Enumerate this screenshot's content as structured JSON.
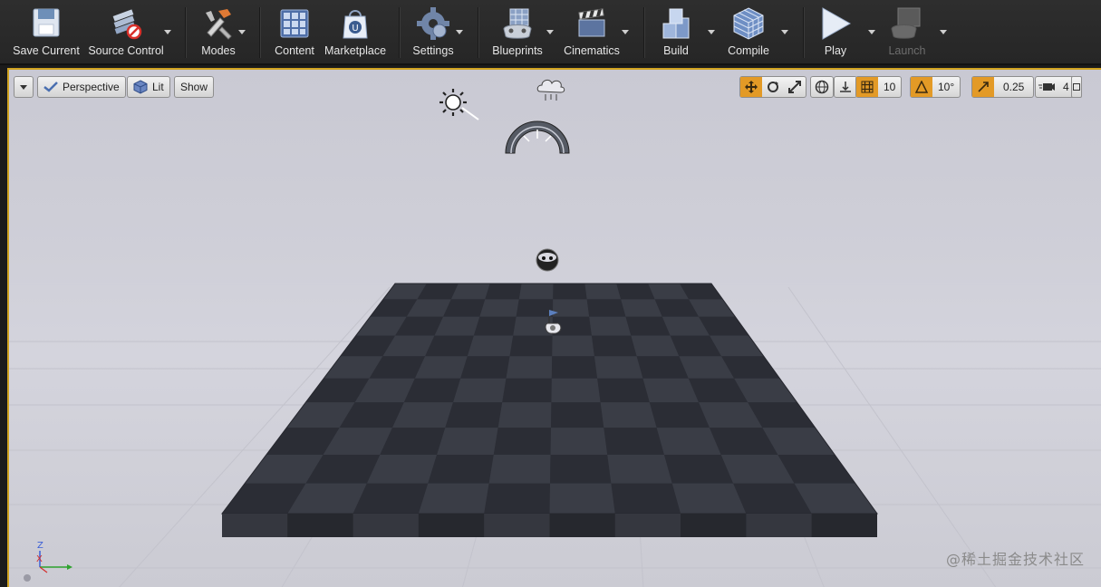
{
  "toolbar": {
    "save_current": "Save Current",
    "source_control": "Source Control",
    "modes": "Modes",
    "content": "Content",
    "marketplace": "Marketplace",
    "settings": "Settings",
    "blueprints": "Blueprints",
    "cinematics": "Cinematics",
    "build": "Build",
    "compile": "Compile",
    "play": "Play",
    "launch": "Launch"
  },
  "viewport": {
    "view_mode_label": "Perspective",
    "lighting_label": "Lit",
    "show_label": "Show",
    "grid_snap_value": "10",
    "rotation_snap_value": "10°",
    "scale_snap_value": "0.25",
    "camera_speed_value": "4",
    "axis": {
      "z": "Z",
      "x": "X"
    }
  },
  "watermark": "@稀土掘金技术社区",
  "colors": {
    "accent": "#d0a320",
    "active_toggle": "#e39a26",
    "toolbar_bg": "#2a2a2a",
    "viewport_sky": "#cfcfd8",
    "floor_dark": "#2b2d35",
    "floor_light": "#3a3d46"
  },
  "icons": [
    "save-icon",
    "source-control-icon",
    "modes-icon",
    "content-icon",
    "marketplace-icon",
    "settings-icon",
    "blueprints-icon",
    "cinematics-icon",
    "build-icon",
    "compile-icon",
    "play-icon",
    "launch-icon"
  ]
}
